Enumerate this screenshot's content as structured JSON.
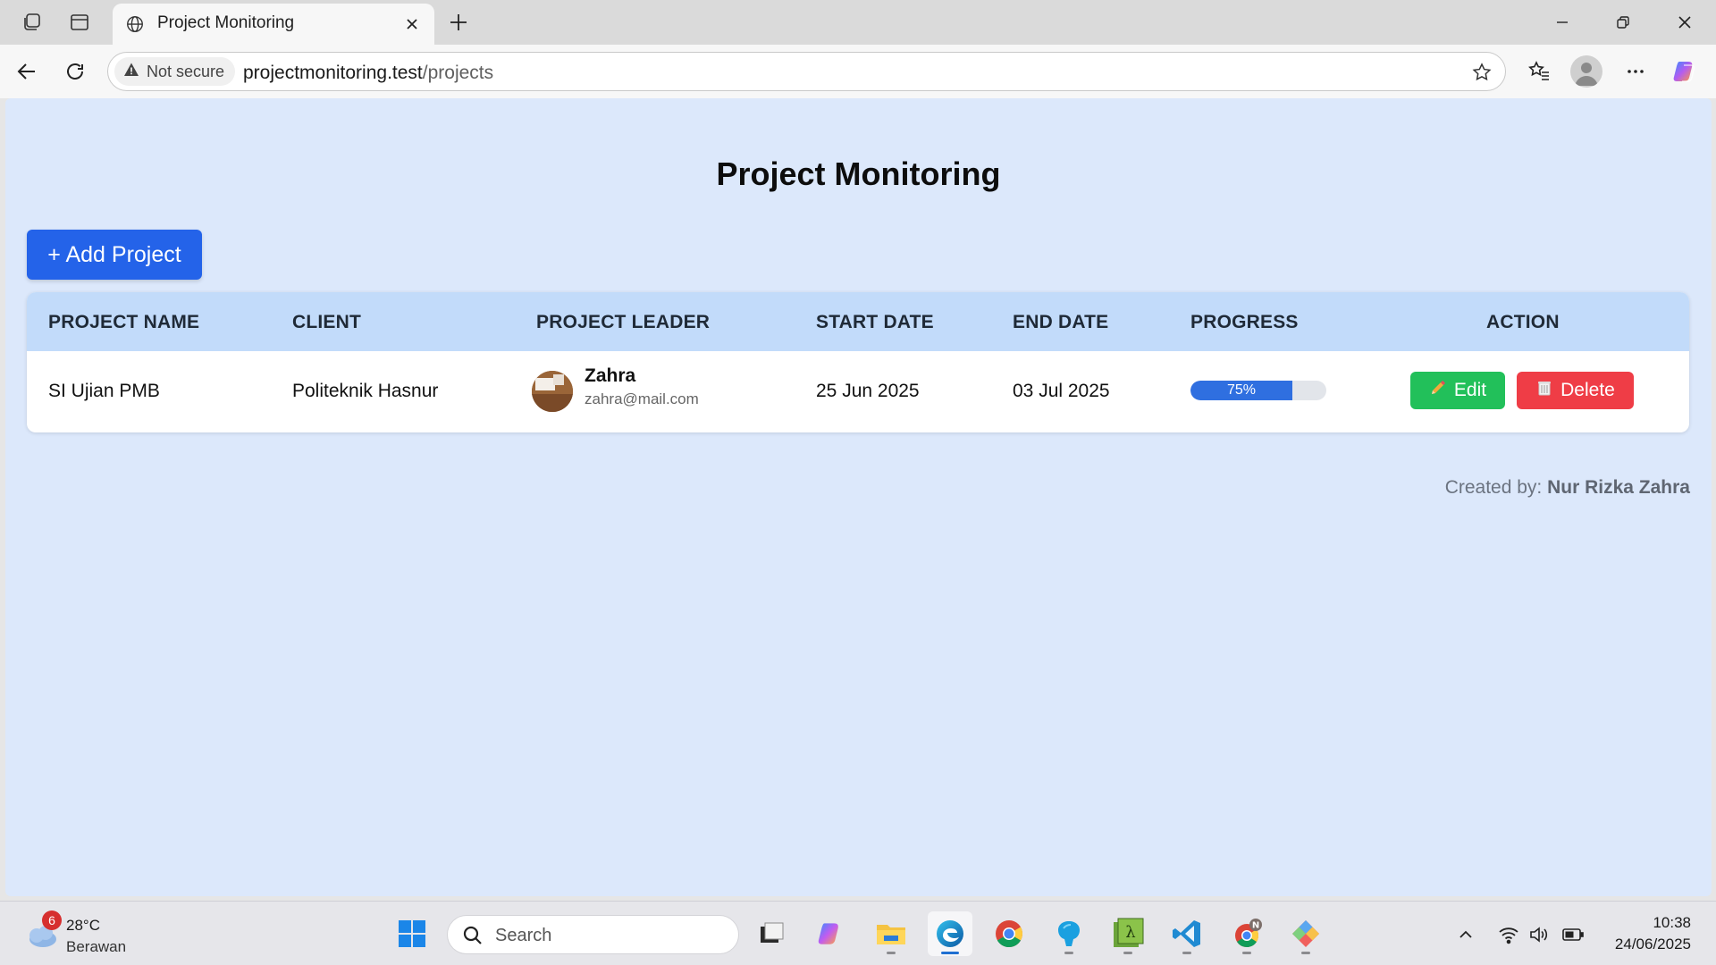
{
  "browser": {
    "tab_title": "Project Monitoring",
    "security_label": "Not secure",
    "url_host": "projectmonitoring.test",
    "url_path": "/projects"
  },
  "page": {
    "title": "Project Monitoring",
    "add_button_label": "+ Add Project",
    "table": {
      "headers": [
        "PROJECT NAME",
        "CLIENT",
        "PROJECT LEADER",
        "START DATE",
        "END DATE",
        "PROGRESS",
        "ACTION"
      ],
      "rows": [
        {
          "project_name": "SI Ujian PMB",
          "client": "Politeknik Hasnur",
          "leader_name": "Zahra",
          "leader_email": "zahra@mail.com",
          "start_date": "25 Jun 2025",
          "end_date": "03 Jul 2025",
          "progress_label": "75%",
          "progress_value": 75,
          "edit_label": "Edit",
          "delete_label": "Delete"
        }
      ]
    },
    "footer_prefix": "Created by:",
    "footer_author": "Nur Rizka Zahra"
  },
  "taskbar": {
    "weather_badge": "6",
    "weather_temp": "28°C",
    "weather_desc": "Berawan",
    "search_placeholder": "Search",
    "time": "10:38",
    "date": "24/06/2025"
  },
  "colors": {
    "page_bg": "#dce8fb",
    "table_header_bg": "#c2dbfa",
    "primary_button": "#2463e9",
    "edit_button": "#22c05a",
    "delete_button": "#ef3d46",
    "progress_fill": "#2f6fe0"
  }
}
